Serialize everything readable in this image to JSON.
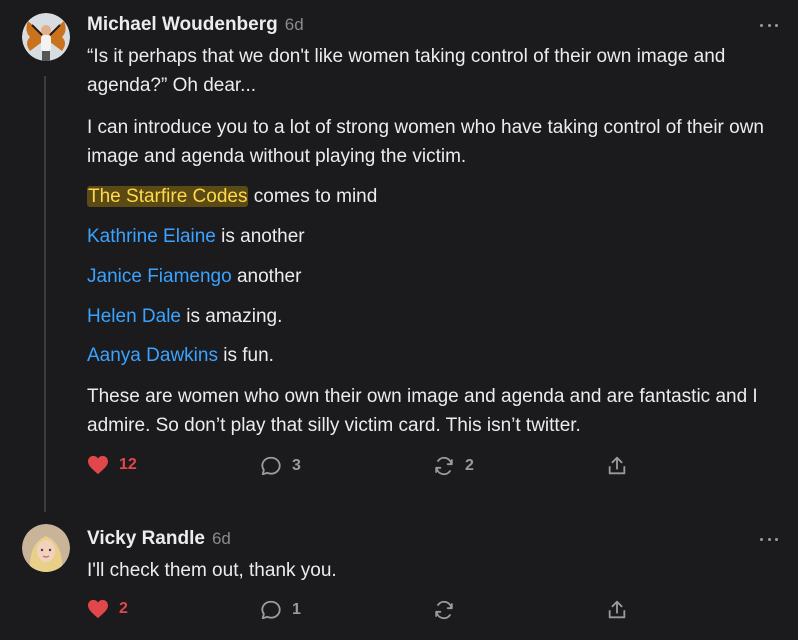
{
  "comments": [
    {
      "author": "Michael Woudenberg",
      "time": "6d",
      "avatar": "butterfly-avatar",
      "paragraphs": {
        "p1": "“Is it perhaps that we don't like women taking control of their own image and agenda?” Oh dear...",
        "p2": "I can introduce you to a lot of strong women who have taking control of their own image and agenda without playing the victim.",
        "p3_link": "The Starfire Codes",
        "p3_rest": " comes to mind",
        "p4_link": "Kathrine Elaine",
        "p4_rest": " is another",
        "p5_link": "Janice Fiamengo",
        "p5_rest": " another",
        "p6_link": "Helen Dale",
        "p6_rest": " is amazing.",
        "p7_link": "Aanya Dawkins",
        "p7_rest": " is fun.",
        "p8": "These are women who own their own image and agenda and are fantastic and I admire. So don’t play that silly victim card. This isn’t twitter."
      },
      "actions": {
        "likes": "12",
        "replies": "3",
        "restacks": "2"
      }
    },
    {
      "author": "Vicky Randle",
      "time": "6d",
      "avatar": "woman-avatar",
      "text": "I'll check them out, thank you.",
      "actions": {
        "likes": "2",
        "replies": "1",
        "restacks": ""
      }
    }
  ],
  "colors": {
    "background": "#1b1b1d",
    "mention": "#3aa3ff",
    "highlight_text": "#ffd94a",
    "like": "#e0474b"
  },
  "icons": [
    "heart-icon",
    "comment-icon",
    "restack-icon",
    "share-icon",
    "more-icon"
  ]
}
